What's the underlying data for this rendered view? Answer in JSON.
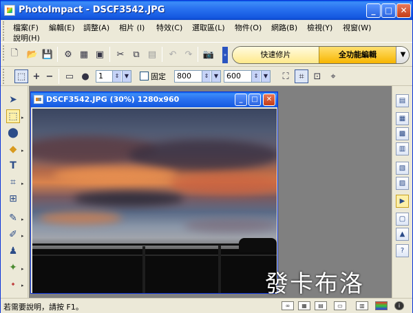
{
  "window": {
    "title": "PhotoImpact - DSCF3542.JPG",
    "min_glyph": "_",
    "max_glyph": "□",
    "close_glyph": "✕"
  },
  "menu": {
    "items": [
      {
        "label": "檔案(F)"
      },
      {
        "label": "編輯(E)"
      },
      {
        "label": "調整(A)"
      },
      {
        "label": "相片 (I)"
      },
      {
        "label": "特效(C)"
      },
      {
        "label": "選取區(L)"
      },
      {
        "label": "物件(O)"
      },
      {
        "label": "網路(B)"
      },
      {
        "label": "檢視(Y)"
      },
      {
        "label": "視窗(W)"
      },
      {
        "label": "說明(H)"
      }
    ]
  },
  "mode_switch": {
    "quick_label": "快速修片",
    "full_label": "全功能編輯",
    "arrow_glyph": "▼"
  },
  "attribute_bar": {
    "brush_size": "1",
    "fixed_label": "固定",
    "width_value": "800",
    "height_value": "600",
    "plus_glyph": "+",
    "minus_glyph": "−"
  },
  "document": {
    "title": "DSCF3542.JPG (30%) 1280x960"
  },
  "watermark": "發卡布洛",
  "status": {
    "help_text": "若需要說明，請按 F1。"
  },
  "colors": {
    "title_blue": "#2a72f0",
    "mode_active": "#f7b500",
    "close_red": "#c43c16"
  }
}
